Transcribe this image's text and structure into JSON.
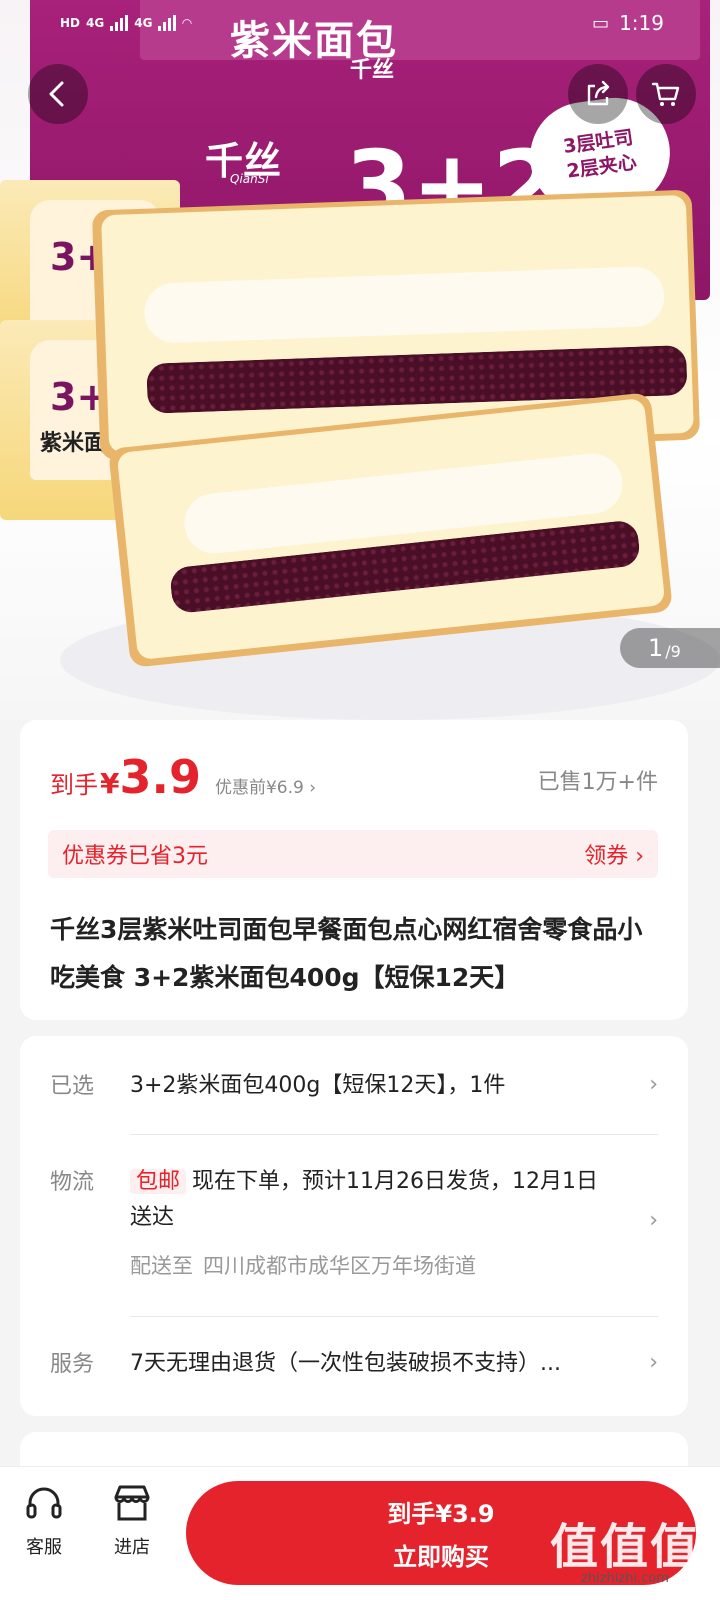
{
  "status_bar": {
    "time": "1:19",
    "network": "4G"
  },
  "hero": {
    "box_top_text": "紫米面包",
    "box_big_text": "3+2",
    "brand_logo": "千丝",
    "brand_logo_en": "QianSi",
    "bubble_line1": "3层吐司",
    "bubble_line2": "2层夹心",
    "bag_label": "3+",
    "bag_sub": "紫米面包",
    "image_index": "1",
    "image_total": "/9"
  },
  "price": {
    "prefix": "到手",
    "yen": "¥",
    "value": "3.9",
    "original": "优惠前¥6.9 ›",
    "sold": "已售1万+件"
  },
  "coupon": {
    "text": "优惠券已省3元",
    "action": "领券 ›"
  },
  "product_title": "千丝3层紫米吐司面包早餐面包点心网红宿舍零食品小吃美食 3+2紫米面包400g【短保12天】",
  "spec": {
    "selected_label": "已选",
    "selected_value": "3+2紫米面包400g【短保12天】，1件",
    "logistics_label": "物流",
    "free_shipping_tag": "包邮",
    "logistics_text": "现在下单，预计11月26日发货，12月1日送达",
    "ship_to_label": "配送至",
    "ship_to_address": "四川成都市成华区万年场街道",
    "service_label": "服务",
    "service_value": "7天无理由退货（一次性包装破损不支持）..."
  },
  "bottom_bar": {
    "service_label": "客服",
    "store_label": "进店",
    "buy_line1": "到手¥3.9",
    "buy_line2": "立即购买"
  },
  "watermark": {
    "main": "值值值",
    "sub": "zhizhizhi.com"
  },
  "colors": {
    "accent": "#e5232c",
    "package_purple": "#8e1667"
  }
}
